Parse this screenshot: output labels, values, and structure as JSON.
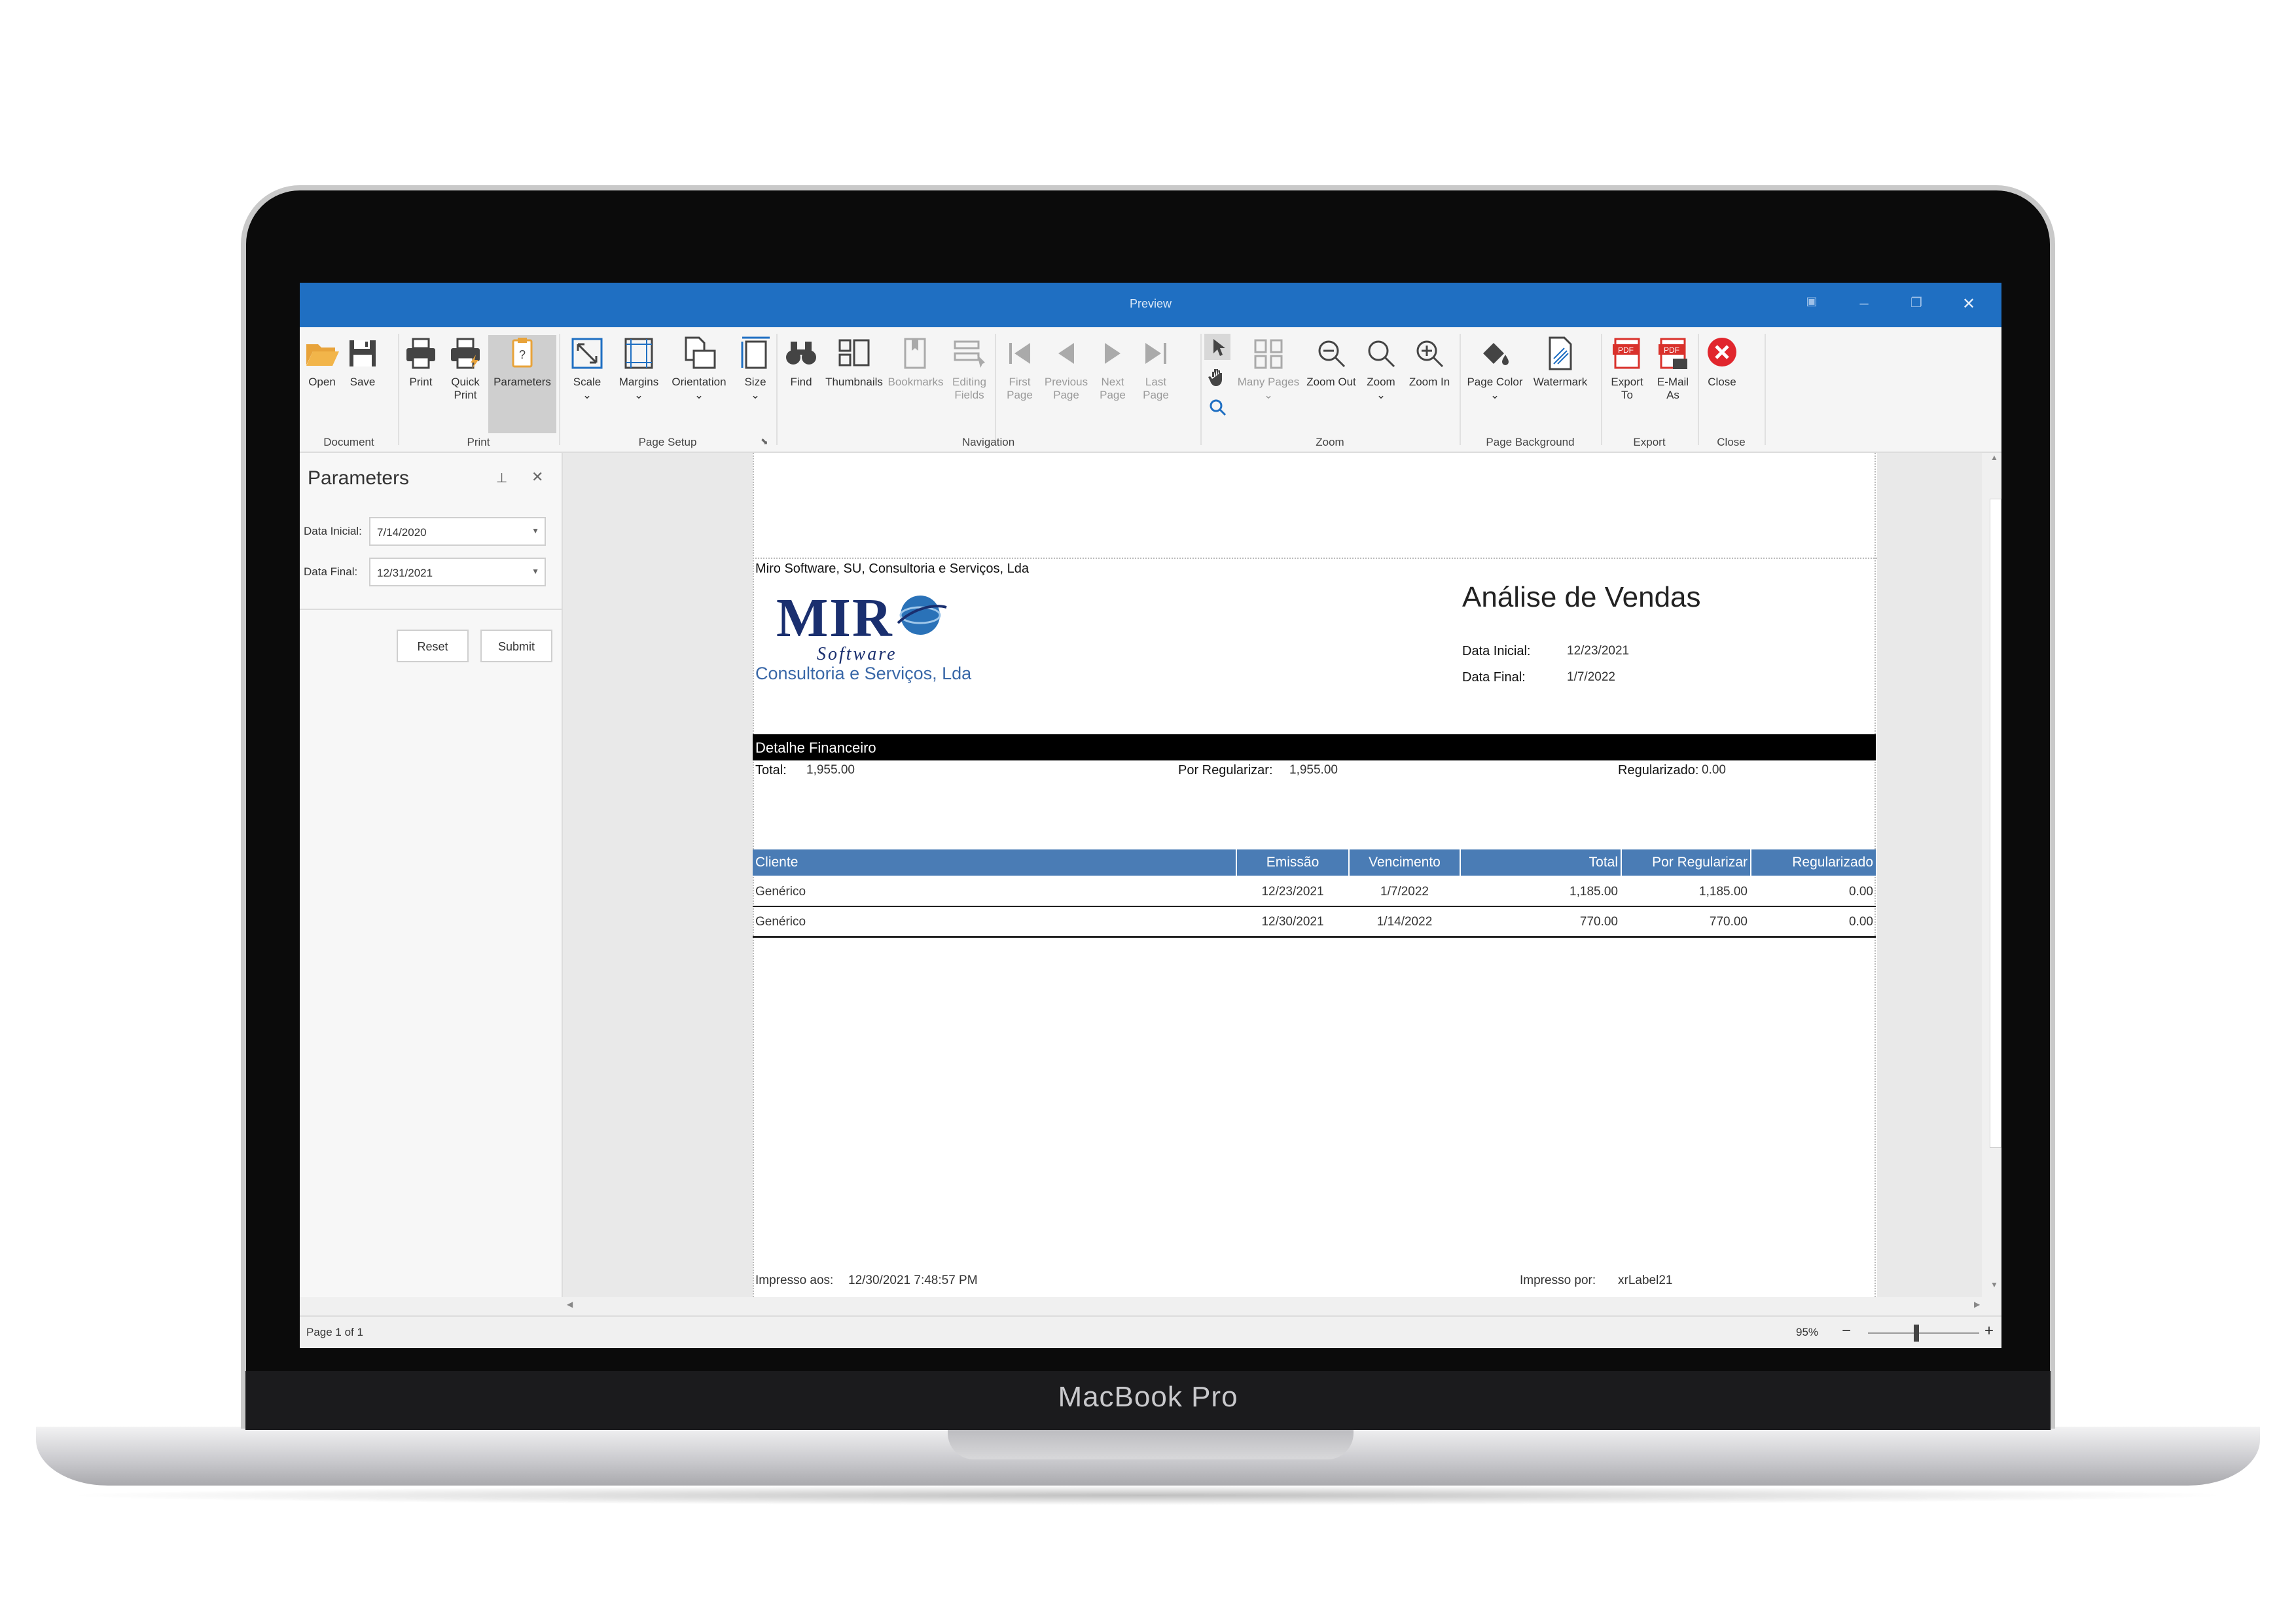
{
  "device": {
    "brand_label": "MacBook Pro"
  },
  "window": {
    "title": "Preview"
  },
  "ribbon": {
    "groups": {
      "document": "Document",
      "print": "Print",
      "page_setup": "Page Setup",
      "navigation": "Navigation",
      "zoom": "Zoom",
      "page_background": "Page Background",
      "export": "Export",
      "close": "Close"
    },
    "buttons": {
      "open": "Open",
      "save": "Save",
      "print": "Print",
      "quick_print_1": "Quick",
      "quick_print_2": "Print",
      "parameters": "Parameters",
      "scale": "Scale",
      "margins": "Margins",
      "orientation": "Orientation",
      "size": "Size",
      "find": "Find",
      "thumbnails": "Thumbnails",
      "bookmarks": "Bookmarks",
      "editing_fields_1": "Editing",
      "editing_fields_2": "Fields",
      "first_page_1": "First",
      "first_page_2": "Page",
      "previous_page_1": "Previous",
      "previous_page_2": "Page",
      "next_page_1": "Next",
      "next_page_2": "Page",
      "last_page_1": "Last",
      "last_page_2": "Page",
      "many_pages": "Many Pages",
      "zoom_out": "Zoom Out",
      "zoom": "Zoom",
      "zoom_in": "Zoom In",
      "page_color": "Page Color",
      "watermark": "Watermark",
      "export_to_1": "Export",
      "export_to_2": "To",
      "email_as_1": "E-Mail",
      "email_as_2": "As",
      "close": "Close"
    }
  },
  "parameters_panel": {
    "title": "Parameters",
    "data_inicial_label": "Data Inicial:",
    "data_inicial_value": "7/14/2020",
    "data_final_label": "Data Final:",
    "data_final_value": "12/31/2021",
    "reset_label": "Reset",
    "submit_label": "Submit"
  },
  "report": {
    "company": "Miro Software, SU, Consultoria e Serviços, Lda",
    "logo_main": "MIR",
    "logo_software": "Software",
    "logo_sub": "Consultoria e Serviços, Lda",
    "title": "Análise de Vendas",
    "data_inicial_label": "Data Inicial:",
    "data_inicial_value": "12/23/2021",
    "data_final_label": "Data Final:",
    "data_final_value": "1/7/2022",
    "section_title": "Detalhe Financeiro",
    "total_label": "Total:",
    "total_value": "1,955.00",
    "por_regularizar_label": "Por Regularizar:",
    "por_regularizar_value": "1,955.00",
    "regularizado_label": "Regularizado:",
    "regularizado_value": "0.00",
    "table": {
      "headers": [
        "Cliente",
        "Emissão",
        "Vencimento",
        "Total",
        "Por Regularizar",
        "Regularizado"
      ],
      "rows": [
        [
          "Genérico",
          "12/23/2021",
          "1/7/2022",
          "1,185.00",
          "1,185.00",
          "0.00"
        ],
        [
          "Genérico",
          "12/30/2021",
          "1/14/2022",
          "770.00",
          "770.00",
          "0.00"
        ]
      ]
    },
    "printed_at_label": "Impresso aos:",
    "printed_at_value": "12/30/2021 7:48:57 PM",
    "printed_by_label": "Impresso por:",
    "printed_by_value": "xrLabel21"
  },
  "status": {
    "page_info": "Page 1 of 1",
    "zoom_level": "95%",
    "zoom_minus": "−",
    "zoom_plus": "+"
  }
}
